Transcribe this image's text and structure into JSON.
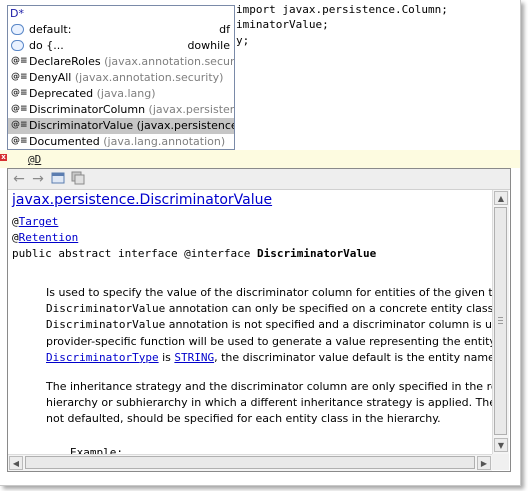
{
  "editor": {
    "code_lines": [
      "import javax.persistence.Column;",
      "iminatorValue;",
      "y;"
    ],
    "current_line_text": "@D",
    "error_marker": "x"
  },
  "completion": {
    "query": "D*",
    "items": [
      {
        "icon": "template-icon",
        "label": "default:",
        "package": "",
        "right": "df"
      },
      {
        "icon": "template-icon",
        "label": "do {...",
        "package": "",
        "right": "dowhile"
      },
      {
        "icon": "annotation-icon",
        "label": "DeclareRoles",
        "package": " (javax.annotation.security)",
        "right": ""
      },
      {
        "icon": "annotation-icon",
        "label": "DenyAll",
        "package": " (javax.annotation.security)",
        "right": ""
      },
      {
        "icon": "annotation-icon",
        "label": "Deprecated",
        "package": " (java.lang)",
        "right": ""
      },
      {
        "icon": "annotation-icon",
        "label": "DiscriminatorColumn",
        "package": " (javax.persistence)",
        "right": ""
      },
      {
        "icon": "annotation-icon",
        "label": "DiscriminatorValue",
        "package": " (javax.persistence)",
        "right": "",
        "selected": true
      },
      {
        "icon": "annotation-icon",
        "label": "Documented",
        "package": " (java.lang.annotation)",
        "right": ""
      }
    ]
  },
  "doc": {
    "toolbar": {
      "back": "back-arrow-icon",
      "forward": "forward-arrow-icon",
      "browser": "open-in-browser-icon",
      "source": "go-to-source-icon"
    },
    "title": "javax.persistence.DiscriminatorValue",
    "ann1_at": "@",
    "ann1_link": "Target",
    "ann2_at": "@",
    "ann2_link": "Retention",
    "decl_prefix": "public abstract interface @interface ",
    "decl_name": "DiscriminatorValue",
    "p1": {
      "l1": "Is used to specify the value of the discriminator column for entities of the given type. The",
      "l2_code": "DiscriminatorValue",
      "l2_rest": " annotation can only be specified on a concrete entity class. If the",
      "l3_code": "DiscriminatorValue",
      "l3_rest": " annotation is not specified and a discriminator column is used, a",
      "l4": "provider-specific function will be used to generate a value representing the entity type. If th",
      "l5_link1": "DiscriminatorType",
      "l5_is": " is ",
      "l5_link2": "STRING",
      "l5_rest": ", the discriminator value default is the entity name."
    },
    "p2": {
      "l1": "The inheritance strategy and the discriminator column are only specified in the root of an ent",
      "l2": "hierarchy or subhierarchy in which a different inheritance strategy is applied. The discriminat",
      "l3": "not defaulted, should be specified for each entity class in the hierarchy."
    },
    "example": "Example:"
  },
  "colors": {
    "link": "#0000cc",
    "selection": "#c6c6c6",
    "current_line": "#fdfbe0",
    "error": "#d63030"
  }
}
